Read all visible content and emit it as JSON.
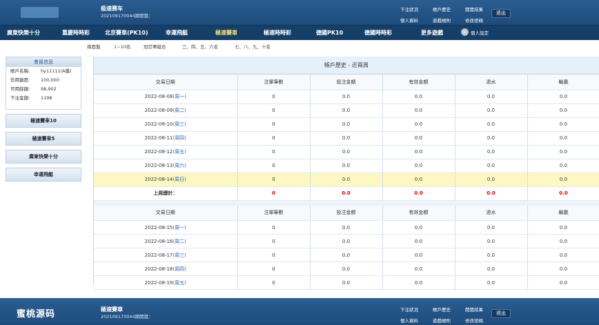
{
  "header": {
    "game": "极速赛车",
    "period": "20210917004​4期開獎：",
    "links": [
      "下注狀況",
      "帳戶歷史",
      "開獎結果",
      "個人資料",
      "遊戲規則",
      "修改密碼"
    ],
    "logout": "退出"
  },
  "nav": {
    "items": [
      "廣東快樂十分",
      "重慶時時彩",
      "北京賽車(PK10)",
      "幸運飛艇",
      "極速賽車",
      "極速時時彩",
      "德國PK10",
      "德國時時彩",
      "更多遊戲"
    ],
    "active_index": 4,
    "settings": "個人設定"
  },
  "subnav": {
    "items": [
      "兩面盤",
      "1~10名",
      "冠亞軍組合",
      "三、四、五、六名",
      "七、八、九、十名"
    ]
  },
  "sidebar": {
    "member_title": "會員信息",
    "fields": [
      {
        "key": "賬戶名稱:",
        "value": "hy11111(A盤)"
      },
      {
        "key": "信用額度:",
        "value": "100,000"
      },
      {
        "key": "可用餘額:",
        "value": "98,902"
      },
      {
        "key": "下注金額:",
        "value": "1198"
      }
    ],
    "buttons": [
      "極速賽車10",
      "極速賽車5",
      "廣東快樂十分",
      "幸運飛艇"
    ]
  },
  "main": {
    "title": "帳戶歷史 - 近兩周",
    "columns": [
      "交易日期",
      "注單筆數",
      "投注金額",
      "有效金額",
      "退水",
      "輸贏"
    ],
    "week1": [
      {
        "date": "2022-08-08",
        "wd": "(周一)",
        "cnt": "0",
        "bet": "0.0",
        "valid": "0.0",
        "rebate": "0.0",
        "win": "0.0"
      },
      {
        "date": "2022-08-09",
        "wd": "(周二)",
        "cnt": "0",
        "bet": "0.0",
        "valid": "0.0",
        "rebate": "0.0",
        "win": "0.0"
      },
      {
        "date": "2022-08-10",
        "wd": "(周三)",
        "cnt": "0",
        "bet": "0.0",
        "valid": "0.0",
        "rebate": "0.0",
        "win": "0.0"
      },
      {
        "date": "2022-08-11",
        "wd": "(周四)",
        "cnt": "0",
        "bet": "0.0",
        "valid": "0.0",
        "rebate": "0.0",
        "win": "0.0"
      },
      {
        "date": "2022-08-12",
        "wd": "(周五)",
        "cnt": "0",
        "bet": "0.0",
        "valid": "0.0",
        "rebate": "0.0",
        "win": "0.0"
      },
      {
        "date": "2022-08-13",
        "wd": "(周六)",
        "cnt": "0",
        "bet": "0.0",
        "valid": "0.0",
        "rebate": "0.0",
        "win": "0.0"
      },
      {
        "date": "2022-08-14",
        "wd": "(周日)",
        "cnt": "0",
        "bet": "0.0",
        "valid": "0.0",
        "rebate": "0.0",
        "win": "0.0"
      }
    ],
    "total": {
      "label": "上周總計：",
      "cnt": "0",
      "bet": "0.0",
      "valid": "0.0",
      "rebate": "0.0",
      "win": "0.0"
    },
    "week2": [
      {
        "date": "2022-08-15",
        "wd": "(周一)",
        "cnt": "0",
        "bet": "0.0",
        "valid": "0.0",
        "rebate": "0.0",
        "win": "0.0"
      },
      {
        "date": "2022-08-16",
        "wd": "(周二)",
        "cnt": "0",
        "bet": "0.0",
        "valid": "0.0",
        "rebate": "0.0",
        "win": "0.0"
      },
      {
        "date": "2022-08-17",
        "wd": "(周三)",
        "cnt": "0",
        "bet": "0.0",
        "valid": "0.0",
        "rebate": "0.0",
        "win": "0.0"
      },
      {
        "date": "2022-08-18",
        "wd": "(周四)",
        "cnt": "0",
        "bet": "0.0",
        "valid": "0.0",
        "rebate": "0.0",
        "win": "0.0"
      },
      {
        "date": "2022-08-19",
        "wd": "(周五)",
        "cnt": "0",
        "bet": "0.0",
        "valid": "0.0",
        "rebate": "0.0",
        "win": "0.0"
      }
    ]
  },
  "footer": {
    "brand": "蜜桃源码",
    "game": "極速賽車",
    "period": "20210917004​4期開獎：",
    "links": [
      "下注狀況",
      "帳戶歷史",
      "開獎結果",
      "個人資料",
      "遊戲規則",
      "修改密碼"
    ],
    "logout": "退出"
  },
  "colors": {
    "header": "#1d4c7c",
    "nav": "#163f68",
    "highlight": "#fdf8c2",
    "red": "#d40000",
    "weekday": "#2a5fb0"
  }
}
